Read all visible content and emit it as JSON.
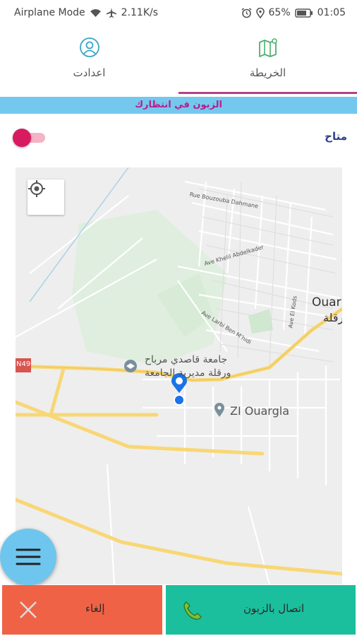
{
  "status_bar": {
    "left_text": "Airplane Mode",
    "speed": "2.11K/s",
    "battery": "65%",
    "time": "01:05"
  },
  "tabs": [
    {
      "label": "اعدادت",
      "icon": "profile-icon",
      "selected": false
    },
    {
      "label": "الخريطة",
      "icon": "map-icon",
      "selected": true
    }
  ],
  "colors": {
    "tab_indicator": "#b3428a",
    "banner_bg": "#74c8ee",
    "banner_text": "#b81c8a",
    "cancel_bg": "#f06246",
    "call_bg": "#1bbf9d",
    "fab_bg": "#6ec6ee"
  },
  "banner": {
    "text": "الزبون في انتظارك"
  },
  "availability": {
    "label": "متاح",
    "enabled": true
  },
  "map": {
    "labels": {
      "street_1": "Rue Bouzouba Dahmane",
      "street_2": "Ave Khelil Abdelkader",
      "street_3": "Ave Larbi Ben M'hidi",
      "street_4": "Ave El Kods",
      "city": "Ouar",
      "city_ar": "ورقلة",
      "road_sign": "N49",
      "poi_university_line1": "جامعة قاصدي مرباح",
      "poi_university_line2": "ورقلة مديرية الجامعة",
      "poi_zi": "ZI Ouargla"
    }
  },
  "actions": {
    "cancel_label": "إلغاء",
    "call_label": "اتصال بالزبون"
  }
}
